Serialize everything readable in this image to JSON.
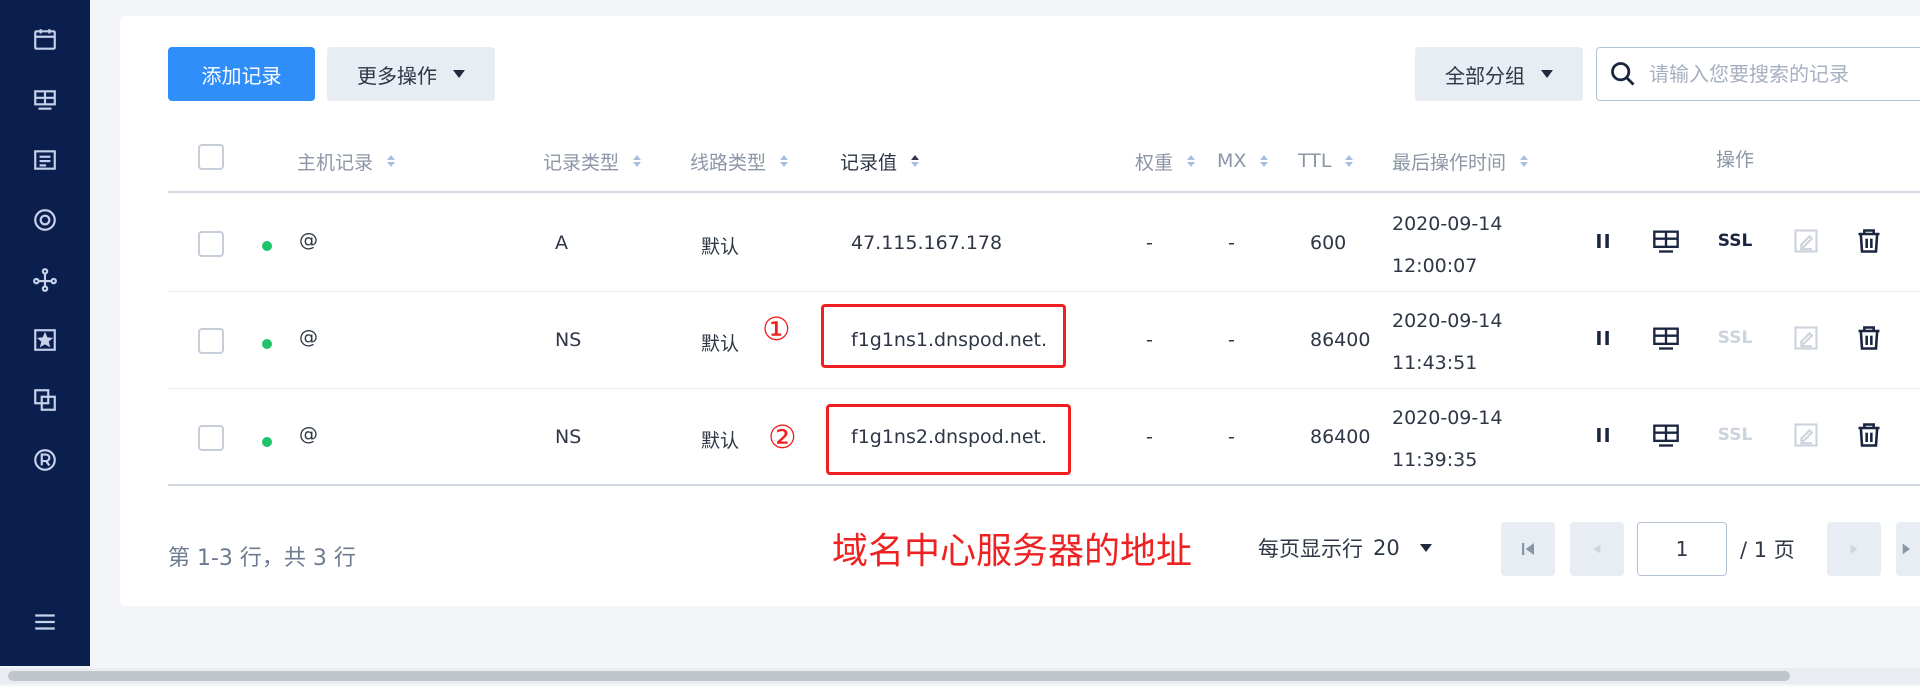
{
  "sidebar": {
    "icons": [
      "calendar-icon",
      "dashboard-icon",
      "list-icon",
      "monitor-icon",
      "network-icon",
      "star-box-icon",
      "copy-icon",
      "registered-icon",
      "menu-icon"
    ]
  },
  "toolbar": {
    "add_label": "添加记录",
    "more_label": "更多操作",
    "group_label": "全部分组",
    "search_placeholder": "请输入您要搜索的记录"
  },
  "table": {
    "headers": {
      "host": "主机记录",
      "type": "记录类型",
      "line": "线路类型",
      "value": "记录值",
      "weight": "权重",
      "mx": "MX",
      "ttl": "TTL",
      "time": "最后操作时间",
      "ops": "操作"
    },
    "rows": [
      {
        "host": "@",
        "type": "A",
        "line": "默认",
        "value": "47.115.167.178",
        "weight": "-",
        "mx": "-",
        "ttl": "600",
        "date": "2020-09-14",
        "time": "12:00:07",
        "ssl": "SSL",
        "ssl_enabled": true
      },
      {
        "host": "@",
        "type": "NS",
        "line": "默认",
        "value": "f1g1ns1.dnspod.net.",
        "weight": "-",
        "mx": "-",
        "ttl": "86400",
        "date": "2020-09-14",
        "time": "11:43:51",
        "ssl": "SSL",
        "ssl_enabled": false
      },
      {
        "host": "@",
        "type": "NS",
        "line": "默认",
        "value": "f1g1ns2.dnspod.net.",
        "weight": "-",
        "mx": "-",
        "ttl": "86400",
        "date": "2020-09-14",
        "time": "11:39:35",
        "ssl": "SSL",
        "ssl_enabled": false
      }
    ],
    "status_color": "#20c26a"
  },
  "annotations": {
    "mark1": "①",
    "mark2": "②",
    "note": "域名中心服务器的地址",
    "color": "#f02020"
  },
  "footer": {
    "count": "第 1-3 行，共 3 行",
    "per_page_label": "每页显示行",
    "per_page_value": "20",
    "page_value": "1",
    "page_total": "/ 1 页"
  },
  "colors": {
    "sidebar": "#0b1f4f",
    "primary": "#2f8ef9"
  }
}
